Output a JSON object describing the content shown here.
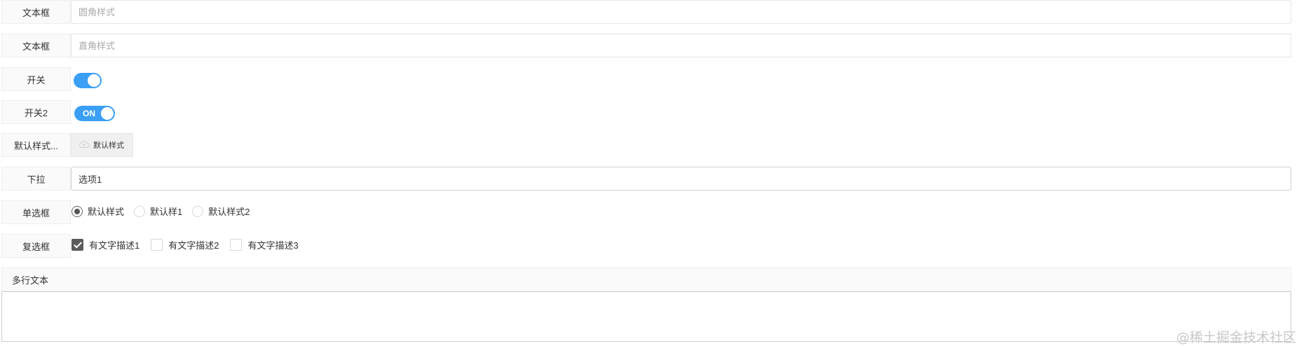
{
  "rows": [
    {
      "label": "文本框",
      "placeholder": "圆角样式"
    },
    {
      "label": "文本框",
      "placeholder": "直角样式"
    },
    {
      "label": "开关",
      "checked": true
    },
    {
      "label": "开关2",
      "checked": true,
      "on_text": "ON"
    },
    {
      "label": "默认样式...",
      "button_text": "默认样式",
      "icon": "upload-cloud-icon"
    },
    {
      "label": "下拉",
      "selected": "选项1"
    },
    {
      "label": "单选框",
      "options": [
        {
          "text": "默认样式",
          "checked": true
        },
        {
          "text": "默认样1",
          "checked": false
        },
        {
          "text": "默认样式2",
          "checked": false
        }
      ]
    },
    {
      "label": "复选框",
      "options": [
        {
          "text": "有文字描述1",
          "checked": true
        },
        {
          "text": "有文字描述2",
          "checked": false
        },
        {
          "text": "有文字描述3",
          "checked": false
        }
      ]
    }
  ],
  "textarea": {
    "label": "多行文本",
    "value": ""
  },
  "watermark": "@稀土掘金技术社区",
  "colors": {
    "accent": "#3a9ff5",
    "checked": "#5c5c5c"
  }
}
